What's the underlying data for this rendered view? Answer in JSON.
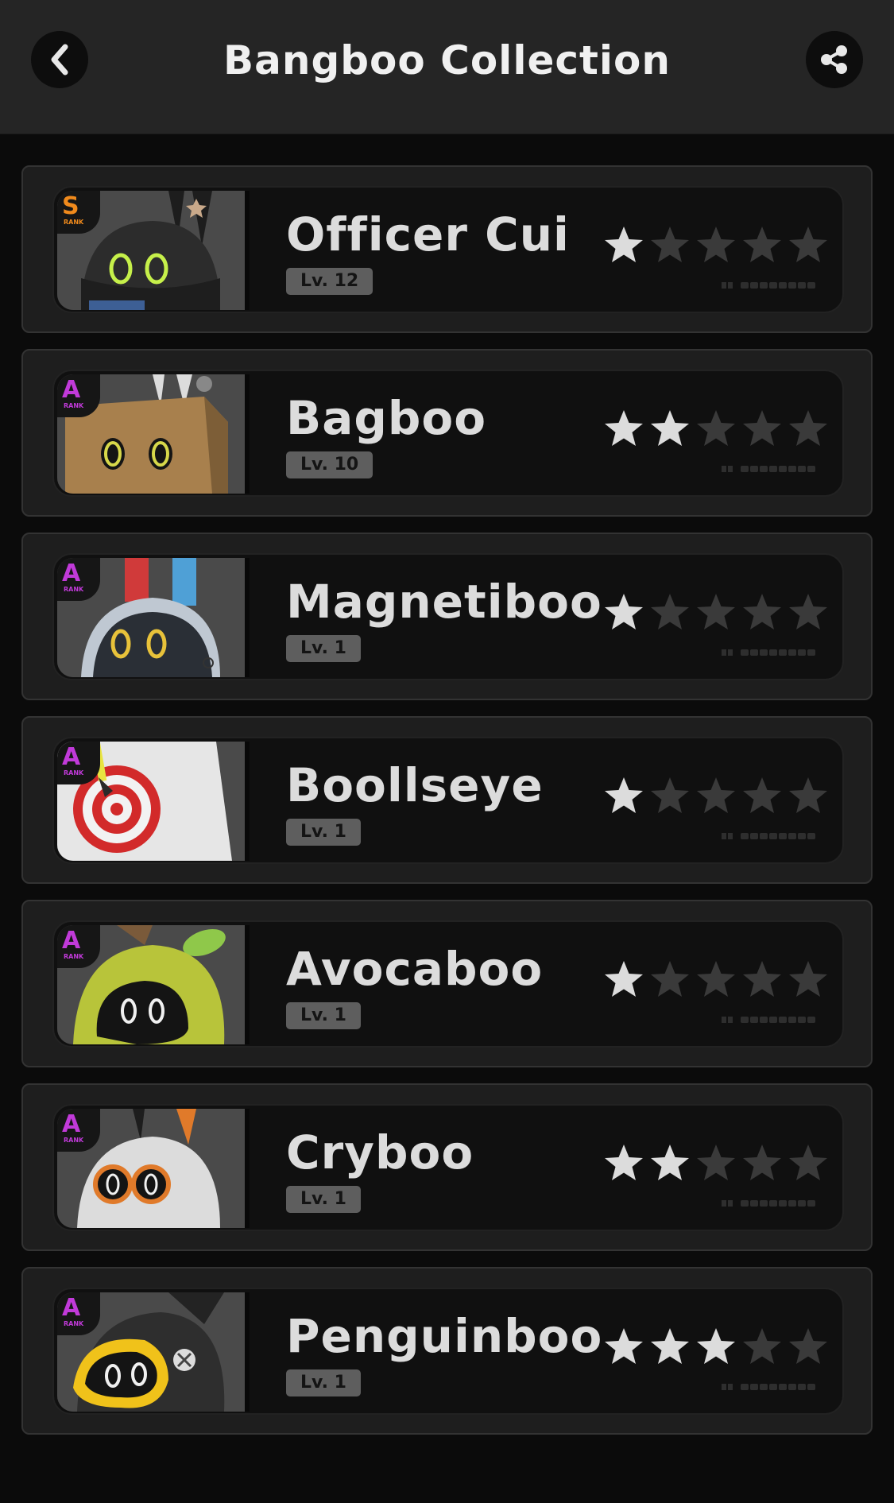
{
  "header": {
    "title": "Bangboo Collection",
    "back_icon": "chevron-left-icon",
    "share_icon": "share-icon"
  },
  "colors": {
    "star_filled": "#dcdcdc",
    "star_empty": "#3a3a3a",
    "rank_s": "#f08a1c",
    "rank_a": "#c13ad9",
    "level_bg": "#5e5e5e"
  },
  "bangboos": [
    {
      "name": "Officer Cui",
      "level": "Lv. 12",
      "rank": "S",
      "rank_sub": "RANK",
      "stars": 1,
      "max_stars": 5,
      "art": "officer-cui"
    },
    {
      "name": "Bagboo",
      "level": "Lv. 10",
      "rank": "A",
      "rank_sub": "RANK",
      "stars": 2,
      "max_stars": 5,
      "art": "bagboo"
    },
    {
      "name": "Magnetiboo",
      "level": "Lv. 1",
      "rank": "A",
      "rank_sub": "RANK",
      "stars": 1,
      "max_stars": 5,
      "art": "magnetiboo"
    },
    {
      "name": "Boollseye",
      "level": "Lv. 1",
      "rank": "A",
      "rank_sub": "RANK",
      "stars": 1,
      "max_stars": 5,
      "art": "boollseye"
    },
    {
      "name": "Avocaboo",
      "level": "Lv. 1",
      "rank": "A",
      "rank_sub": "RANK",
      "stars": 1,
      "max_stars": 5,
      "art": "avocaboo"
    },
    {
      "name": "Cryboo",
      "level": "Lv. 1",
      "rank": "A",
      "rank_sub": "RANK",
      "stars": 2,
      "max_stars": 5,
      "art": "cryboo"
    },
    {
      "name": "Penguinboo",
      "level": "Lv. 1",
      "rank": "A",
      "rank_sub": "RANK",
      "stars": 3,
      "max_stars": 5,
      "art": "penguinboo"
    }
  ]
}
